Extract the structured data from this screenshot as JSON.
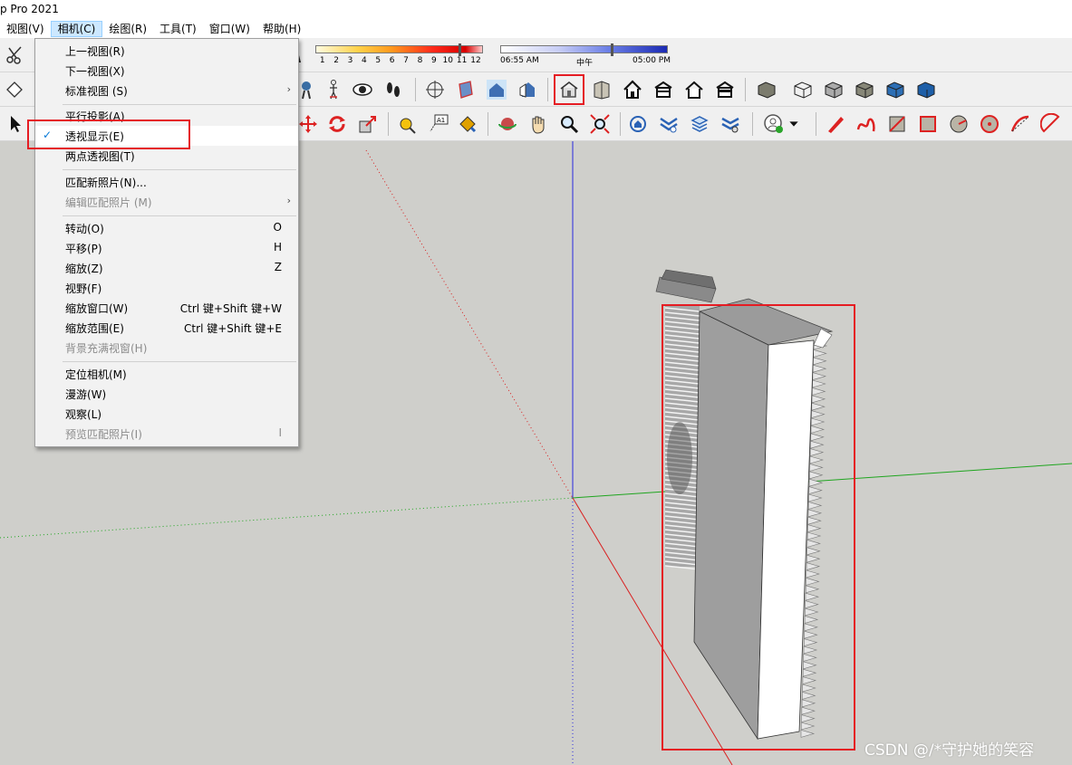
{
  "window": {
    "title": "p Pro 2021"
  },
  "menubar": {
    "items": [
      "视图(V)",
      "相机(C)",
      "绘图(R)",
      "工具(T)",
      "窗口(W)",
      "帮助(H)"
    ],
    "active_index": 1
  },
  "shadow": {
    "month_ticks": [
      "1",
      "2",
      "3",
      "4",
      "5",
      "6",
      "7",
      "8",
      "9",
      "10",
      "11",
      "12"
    ],
    "time_start": "06:55 AM",
    "time_mid": "中午",
    "time_end": "05:00 PM"
  },
  "camera_menu": {
    "items": [
      {
        "label": "上一视图(R)"
      },
      {
        "label": "下一视图(X)"
      },
      {
        "label": "标准视图 (S)",
        "submenu": "›"
      },
      {
        "label": "平行投影(A)"
      },
      {
        "label": "透视显示(E)",
        "checked": true,
        "check_glyph": "✓"
      },
      {
        "label": "两点透视图(T)"
      },
      {
        "label": "匹配新照片(N)..."
      },
      {
        "label": "编辑匹配照片 (M)",
        "disabled": true,
        "submenu": "›"
      },
      {
        "label": "转动(O)",
        "shortcut": "O"
      },
      {
        "label": "平移(P)",
        "shortcut": "H"
      },
      {
        "label": "缩放(Z)",
        "shortcut": "Z"
      },
      {
        "label": "视野(F)"
      },
      {
        "label": "缩放窗口(W)",
        "shortcut": "Ctrl 键+Shift 键+W"
      },
      {
        "label": "缩放范围(E)",
        "shortcut": "Ctrl 键+Shift 键+E"
      },
      {
        "label": "背景充满视窗(H)",
        "disabled": true
      },
      {
        "label": "定位相机(M)"
      },
      {
        "label": "漫游(W)"
      },
      {
        "label": "观察(L)"
      },
      {
        "label": "预览匹配照片(I)",
        "disabled": true,
        "shortcut": "I"
      }
    ]
  },
  "watermark": "CSDN @/*守护她的笑容",
  "colors": {
    "highlight_red": "#e51c23",
    "axis_blue": "#2a2adf",
    "axis_green": "#1fa51f",
    "axis_red": "#d92020"
  }
}
